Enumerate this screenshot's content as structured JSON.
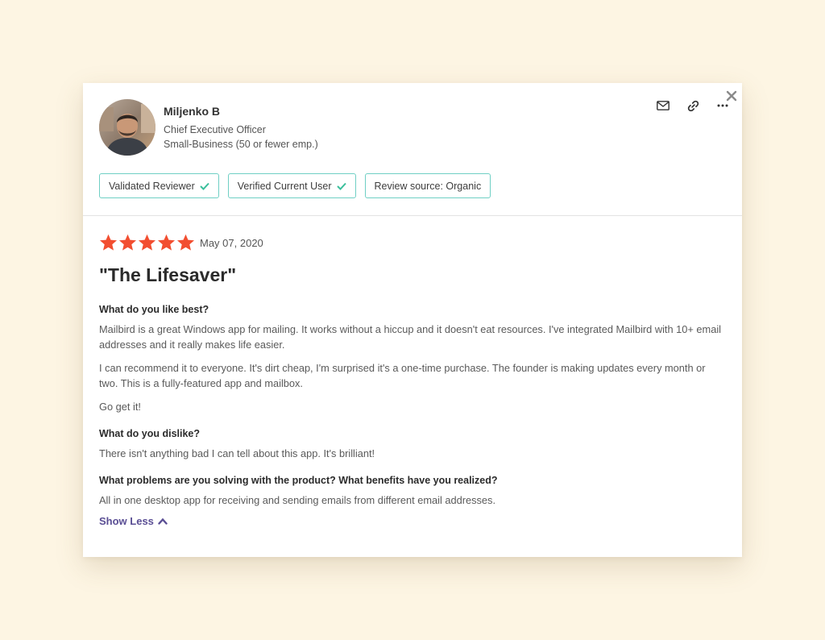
{
  "reviewer": {
    "name": "Miljenko B",
    "title": "Chief Executive Officer",
    "company_size": "Small-Business (50 or fewer emp.)"
  },
  "badges": [
    {
      "label": "Validated Reviewer",
      "checked": true
    },
    {
      "label": "Verified Current User",
      "checked": true
    },
    {
      "label": "Review source: Organic",
      "checked": false
    }
  ],
  "actions": {
    "email_icon": "envelope-icon",
    "link_icon": "link-icon",
    "more_icon": "more-options-icon",
    "close_icon": "close-icon"
  },
  "review": {
    "rating": 5,
    "max_rating": 5,
    "date": "May 07, 2020",
    "title": "\"The Lifesaver\"",
    "sections": [
      {
        "question": "What do you like best?",
        "paragraphs": [
          "Mailbird is a great Windows app for mailing. It works without a hiccup and it doesn't eat resources. I've integrated Mailbird with 10+ email addresses and it really makes life easier.",
          "I can recommend it to everyone. It's dirt cheap, I'm surprised it's a one-time purchase. The founder is making updates every month or two. This is a fully-featured app and mailbox.",
          "Go get it!"
        ]
      },
      {
        "question": "What do you dislike?",
        "paragraphs": [
          "There isn't anything bad I can tell about this app. It's brilliant!"
        ]
      },
      {
        "question": "What problems are you solving with the product? What benefits have you realized?",
        "paragraphs": [
          "All in one desktop app for receiving and sending emails from different email addresses."
        ]
      }
    ],
    "show_less_label": "Show Less"
  },
  "colors": {
    "star": "#f24e30",
    "badge_border": "#6fcfc4",
    "check": "#3bbf9c",
    "link": "#5a4e94",
    "page_bg": "#fdf5e3"
  }
}
